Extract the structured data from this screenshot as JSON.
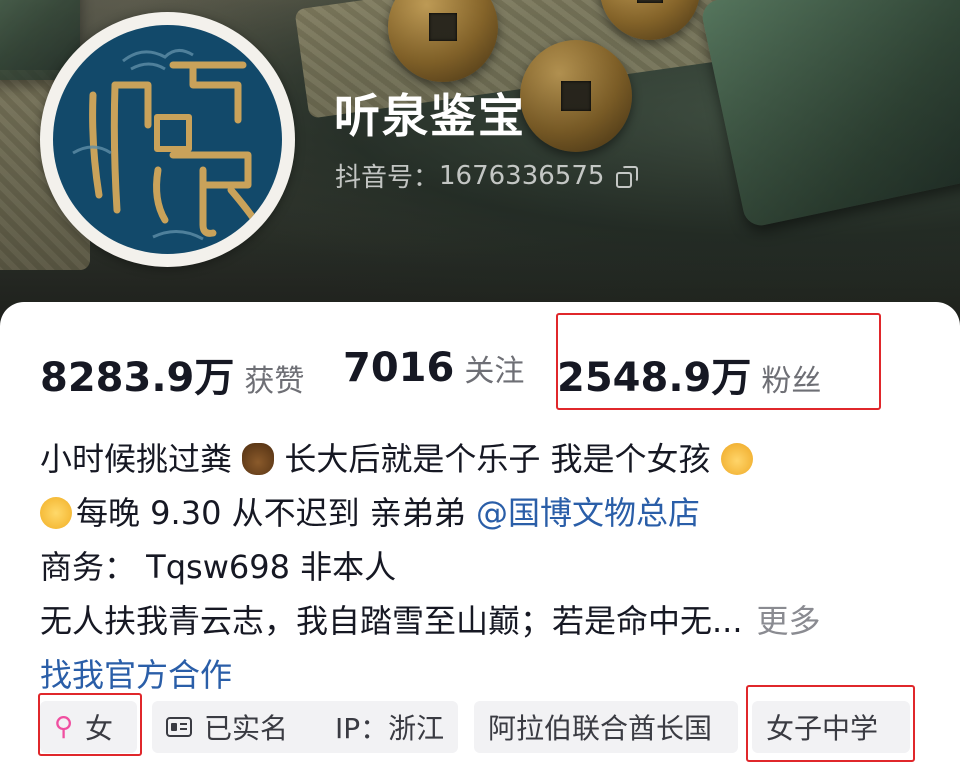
{
  "profile": {
    "name": "听泉鉴宝",
    "douyin_id_label": "抖音号：",
    "douyin_id": "1676336575",
    "avatar_logo_text": "听泉"
  },
  "stats": [
    {
      "value": "8283.9万",
      "label": "获赞"
    },
    {
      "value": "7016",
      "label": "关注"
    },
    {
      "value": "2548.9万",
      "label": "粉丝"
    }
  ],
  "bio": {
    "line1_a": "小时候挑过粪",
    "line1_b": "长大后就是个乐子  我是个女孩",
    "line2_text": "每晚 9.30 从不迟到 亲弟弟 ",
    "line2_mention": "@国博文物总店",
    "line3": "商务：  Tqsw698 非本人",
    "line4": "无人扶我青云志，我自踏雪至山巅；若是命中无...",
    "more": "更多",
    "partner_link": "找我官方合作"
  },
  "tags": {
    "gender": "女",
    "verified": "已实名",
    "ip": "IP：浙江",
    "country": "阿拉伯联合酋长国",
    "school": "女子中学"
  },
  "colors": {
    "avatar_bg": "#12496a",
    "avatar_gold": "#c9a25a",
    "highlight_red": "#e0272b",
    "link_blue": "#2a5ea8",
    "female_pink": "#f04fa0"
  },
  "icons": [
    "copy-icon",
    "female-icon",
    "id-card-icon",
    "poop-emoji",
    "girl-emoji",
    "relieved-emoji"
  ]
}
